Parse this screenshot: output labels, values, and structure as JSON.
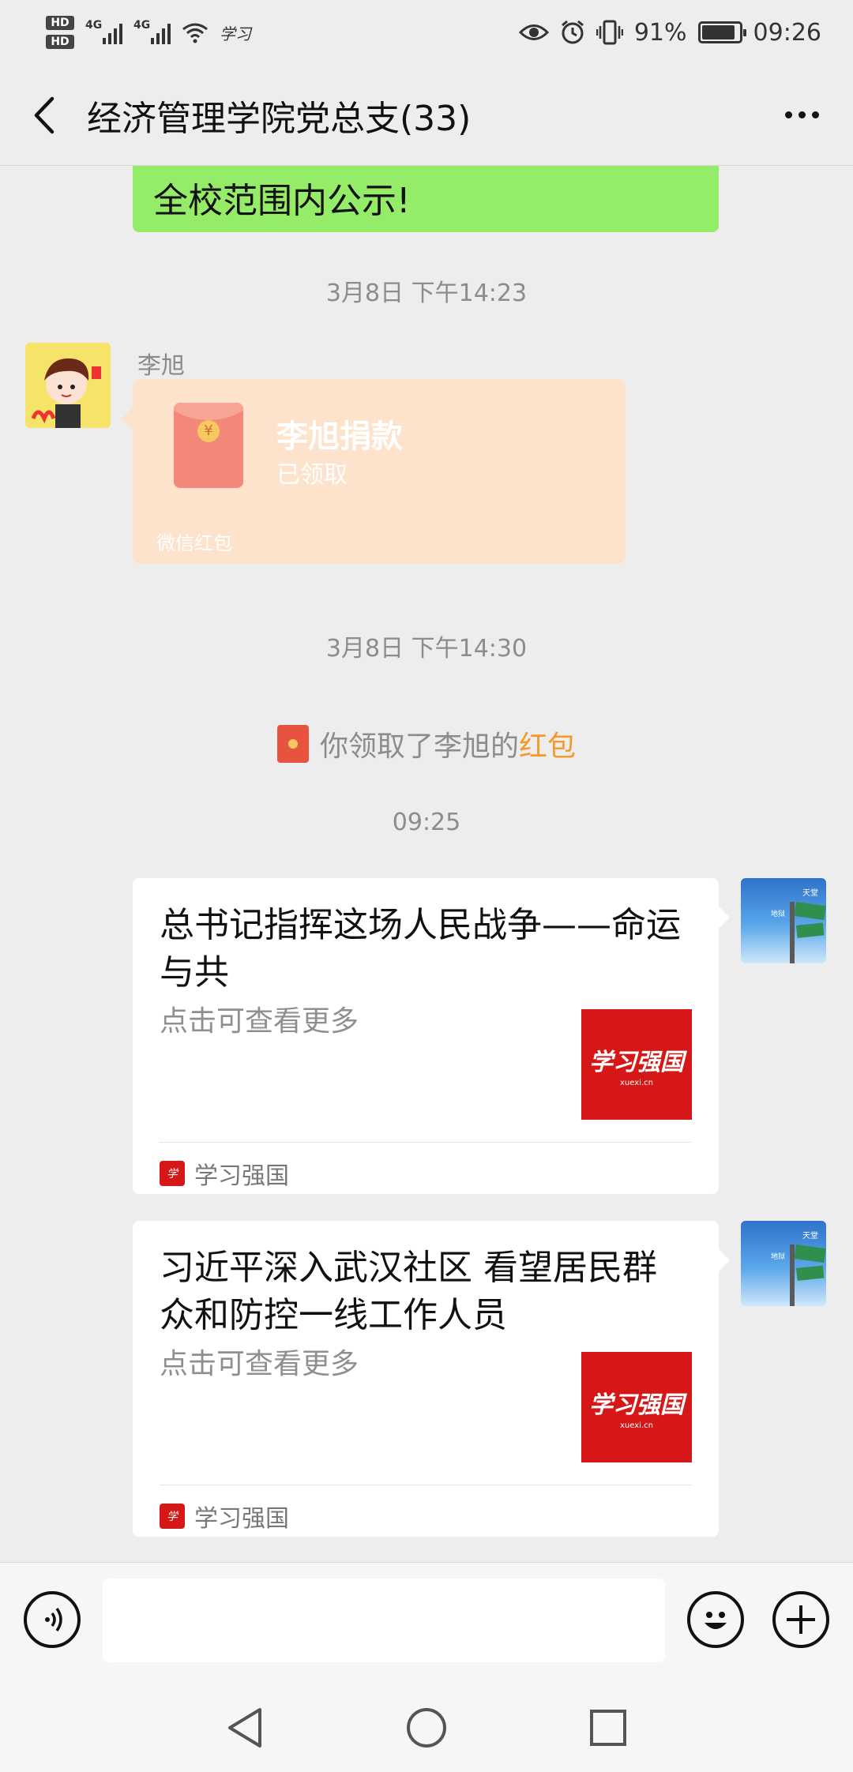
{
  "status_bar": {
    "battery": "91%",
    "battery_level": 0.91,
    "time": "09:26",
    "hd1": "HD",
    "hd2": "HD",
    "net1": "4G",
    "net2": "4G",
    "app_mark": "学习"
  },
  "header": {
    "title": "经济管理学院党总支(33)",
    "back_icon": "chevron-left-icon",
    "more_icon": "more-dots-icon"
  },
  "messages": {
    "partial_text": "全校范围内公示!",
    "time1": "3月8日 下午14:23",
    "sender_name": "李旭",
    "redpacket": {
      "title": "李旭捐款",
      "status": "已领取",
      "footer": "微信红包"
    },
    "time2": "3月8日 下午14:30",
    "system_note": {
      "prefix": "你领取了李旭的",
      "link": "红包"
    },
    "time3": "09:25",
    "cards": [
      {
        "title": "总书记指挥这场人民战争——命运与共",
        "desc": "点击可查看更多",
        "thumb_logo": "学习强国",
        "thumb_sub": "xuexi.cn",
        "source": "学习强国"
      },
      {
        "title": "习近平深入武汉社区 看望居民群众和防控一线工作人员",
        "desc": "点击可查看更多",
        "thumb_logo": "学习强国",
        "thumb_sub": "xuexi.cn",
        "source": "学习强国"
      }
    ]
  },
  "input_bar": {
    "voice_icon": "voice-icon",
    "emoji_icon": "emoji-icon",
    "plus_icon": "plus-icon",
    "input_value": ""
  },
  "system_nav": {
    "back": "triangle-back-icon",
    "home": "circle-home-icon",
    "recents": "square-recents-icon"
  },
  "colors": {
    "background": "#ededed",
    "bubble_green": "#95ec69",
    "redpacket_bg": "#fde2cc",
    "link_orange": "#f39a2b",
    "brand_red": "#d61717"
  }
}
